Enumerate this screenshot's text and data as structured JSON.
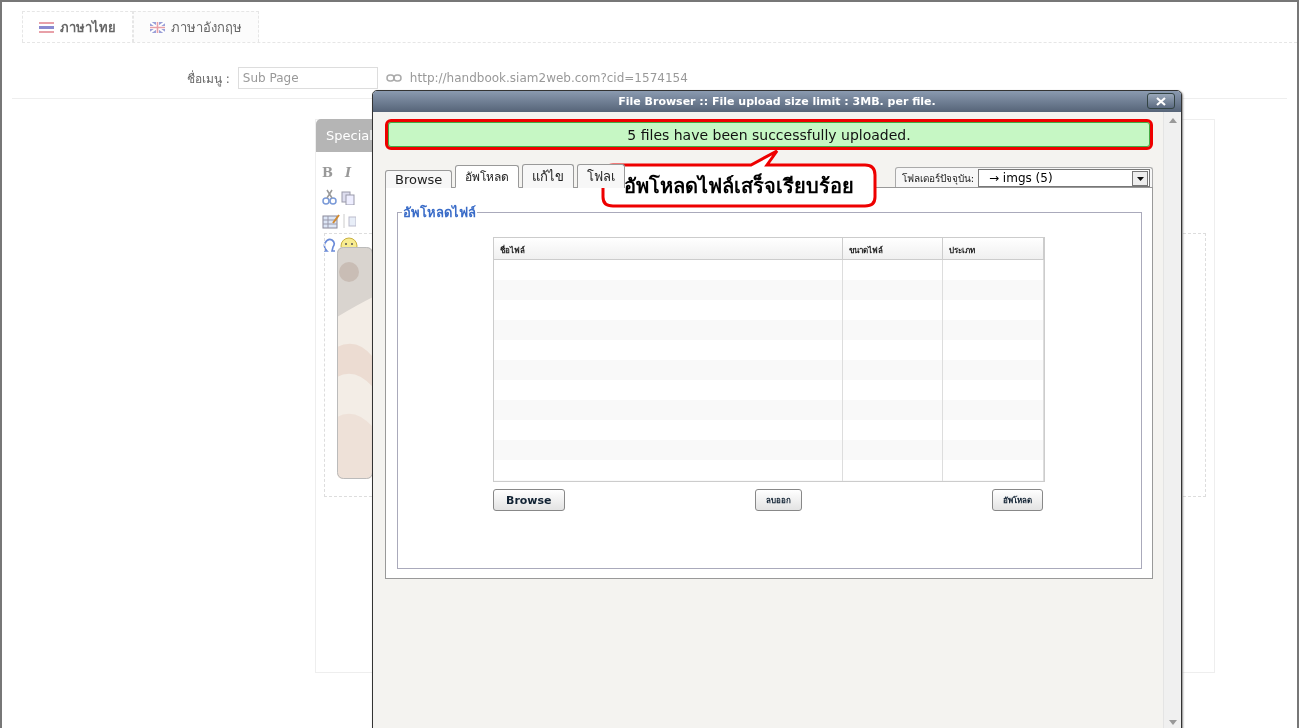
{
  "language_tabs": [
    {
      "label": "ภาษาไทย",
      "kind": "th",
      "selected": true
    },
    {
      "label": "ภาษาอังกฤษ",
      "kind": "uk",
      "selected": false
    }
  ],
  "menu_name": {
    "label": "ชื่อเมนู :",
    "value": "Sub Page",
    "link": "http://handbook.siam2web.com?cid=1574154"
  },
  "editor": {
    "special_button": "Special",
    "format_letters": [
      "B",
      "I"
    ]
  },
  "dialog": {
    "title": "File Browser :: File upload size limit : 3MB. per file.",
    "message": "5 files have been successfully uploaded.",
    "tabs": [
      {
        "label": "Browse",
        "selected": false
      },
      {
        "label": "อัพโหลด",
        "selected": true
      },
      {
        "label": "แก้ไข",
        "selected": false
      },
      {
        "label": "โฟลเ",
        "selected": false
      }
    ],
    "folder_label": "โฟลเดอร์ปัจจุบัน:",
    "folder_value": "→ imgs (5)",
    "legend": "อัพโหลดไฟล์",
    "table": {
      "columns": [
        "ชื่อไฟล์",
        "ขนาดไฟล์",
        "ประเภท"
      ]
    },
    "buttons": [
      "Browse",
      "ลบออก",
      "อัพโหลด"
    ]
  },
  "callout": {
    "text": "อัพโหลดไฟล์เสร็จเรียบร้อย"
  }
}
